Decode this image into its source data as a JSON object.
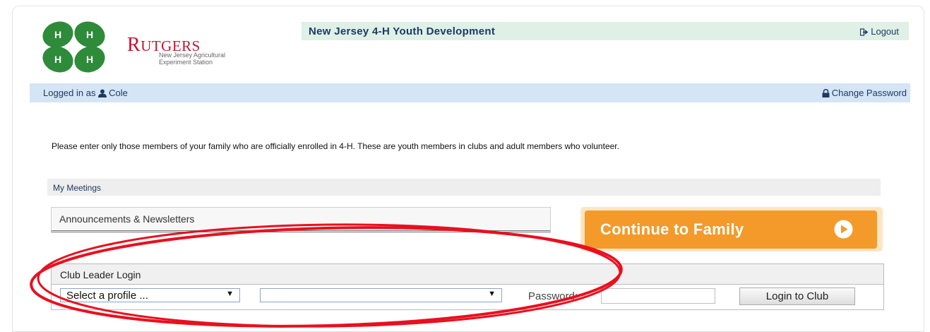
{
  "header": {
    "site_title": "New Jersey 4-H Youth Development",
    "logout_label": "Logout",
    "rutgers_letter": "R",
    "rutgers_rest": "UTGERS",
    "subtitle_line1": "New Jersey Agricultural",
    "subtitle_line2": "Experiment Station"
  },
  "userbar": {
    "logged_in_prefix": "Logged in as",
    "username": "Cole",
    "change_password_label": "Change Password"
  },
  "content": {
    "intro_text": "Please enter only those members of your family who are officially enrolled in 4-H. These are youth members in clubs and adult members who volunteer.",
    "my_meetings_label": "My Meetings",
    "announcements_label": "Announcements & Newsletters",
    "continue_label": "Continue to Family"
  },
  "club_login": {
    "heading": "Club Leader Login",
    "profile_select_value": "Select a profile ...",
    "club_select_value": "",
    "password_label": "Password:",
    "password_value": "",
    "login_button_label": "Login to Club"
  },
  "colors": {
    "rutgers_red": "#c41230",
    "clover_green": "#2e8b3a",
    "continue_orange": "#f39a2a",
    "annotation_red": "#e8101f"
  },
  "icons": [
    "clover-logo-icon",
    "logout-icon",
    "user-icon",
    "lock-icon",
    "play-circle-icon",
    "dropdown-arrow-icon"
  ]
}
